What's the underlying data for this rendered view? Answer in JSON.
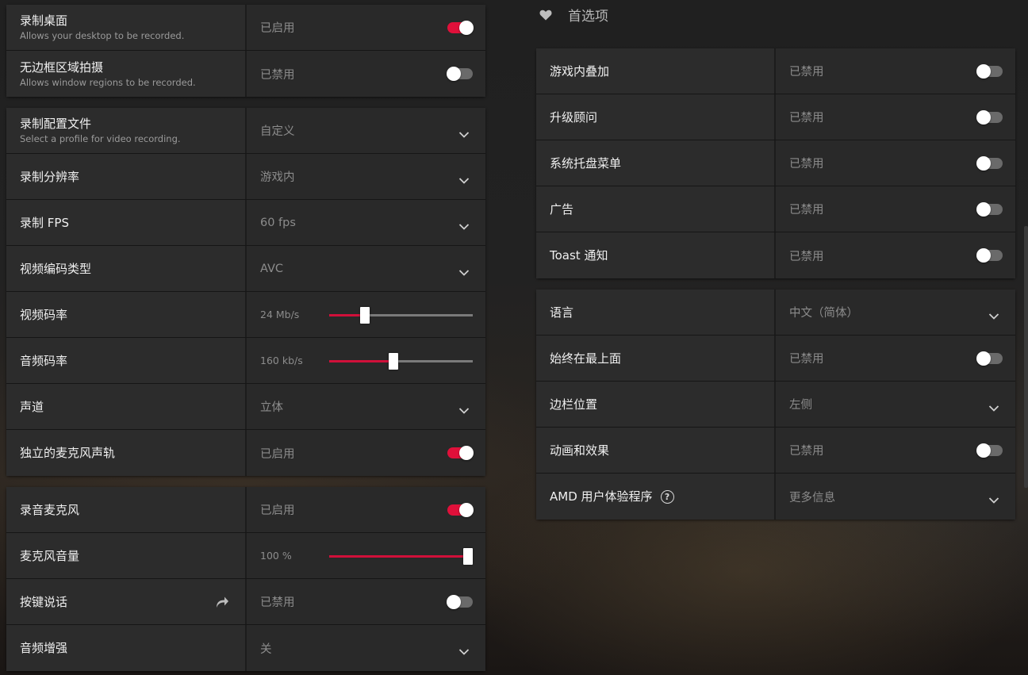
{
  "left": {
    "group1": [
      {
        "label": "录制桌面",
        "desc": "Allows your desktop to be recorded.",
        "value": "已启用",
        "control": "toggle",
        "on": true
      },
      {
        "label": "无边框区域拍摄",
        "desc": "Allows window regions to be recorded.",
        "value": "已禁用",
        "control": "toggle",
        "on": false
      }
    ],
    "group2": [
      {
        "label": "录制配置文件",
        "desc": "Select a profile for video recording.",
        "value": "自定义",
        "control": "dropdown"
      },
      {
        "label": "录制分辨率",
        "value": "游戏内",
        "control": "dropdown"
      },
      {
        "label": "录制 FPS",
        "value": "60 fps",
        "control": "dropdown"
      },
      {
        "label": "视频编码类型",
        "value": "AVC",
        "control": "dropdown"
      },
      {
        "label": "视频码率",
        "value": "24 Mb/s",
        "control": "slider",
        "level": 0.25
      },
      {
        "label": "音频码率",
        "value": "160 kb/s",
        "control": "slider",
        "level": 0.45
      },
      {
        "label": "声道",
        "value": "立体",
        "control": "dropdown"
      },
      {
        "label": "独立的麦克风声轨",
        "value": "已启用",
        "control": "toggle",
        "on": true
      }
    ],
    "group3": [
      {
        "label": "录音麦克风",
        "value": "已启用",
        "control": "toggle",
        "on": true
      },
      {
        "label": "麦克风音量",
        "value": "100 %",
        "control": "slider",
        "level": 1.0
      },
      {
        "label": "按键说话",
        "value": "已禁用",
        "control": "toggle",
        "on": false,
        "label_icon": "share-arrow-icon"
      },
      {
        "label": "音频增强",
        "value": "关",
        "control": "dropdown"
      }
    ]
  },
  "right": {
    "section_title": "首选项",
    "section_icon": "heart-icon",
    "group1": [
      {
        "label": "游戏内叠加",
        "value": "已禁用",
        "control": "toggle",
        "on": false
      },
      {
        "label": "升级顾问",
        "value": "已禁用",
        "control": "toggle",
        "on": false
      },
      {
        "label": "系统托盘菜单",
        "value": "已禁用",
        "control": "toggle",
        "on": false
      },
      {
        "label": "广告",
        "value": "已禁用",
        "control": "toggle",
        "on": false
      },
      {
        "label": "Toast 通知",
        "value": "已禁用",
        "control": "toggle",
        "on": false
      }
    ],
    "group2": [
      {
        "label": "语言",
        "value": "中文（简体）",
        "control": "dropdown"
      },
      {
        "label": "始终在最上面",
        "value": "已禁用",
        "control": "toggle",
        "on": false
      },
      {
        "label": "边栏位置",
        "value": "左侧",
        "control": "dropdown"
      },
      {
        "label": "动画和效果",
        "value": "已禁用",
        "control": "toggle",
        "on": false
      },
      {
        "label": "AMD 用户体验程序",
        "value": "更多信息",
        "control": "dropdown",
        "help_icon": "?"
      }
    ]
  },
  "colors": {
    "accent": "#e0103a",
    "panel": "#262626",
    "toggle_off": "#6a6a6a"
  }
}
